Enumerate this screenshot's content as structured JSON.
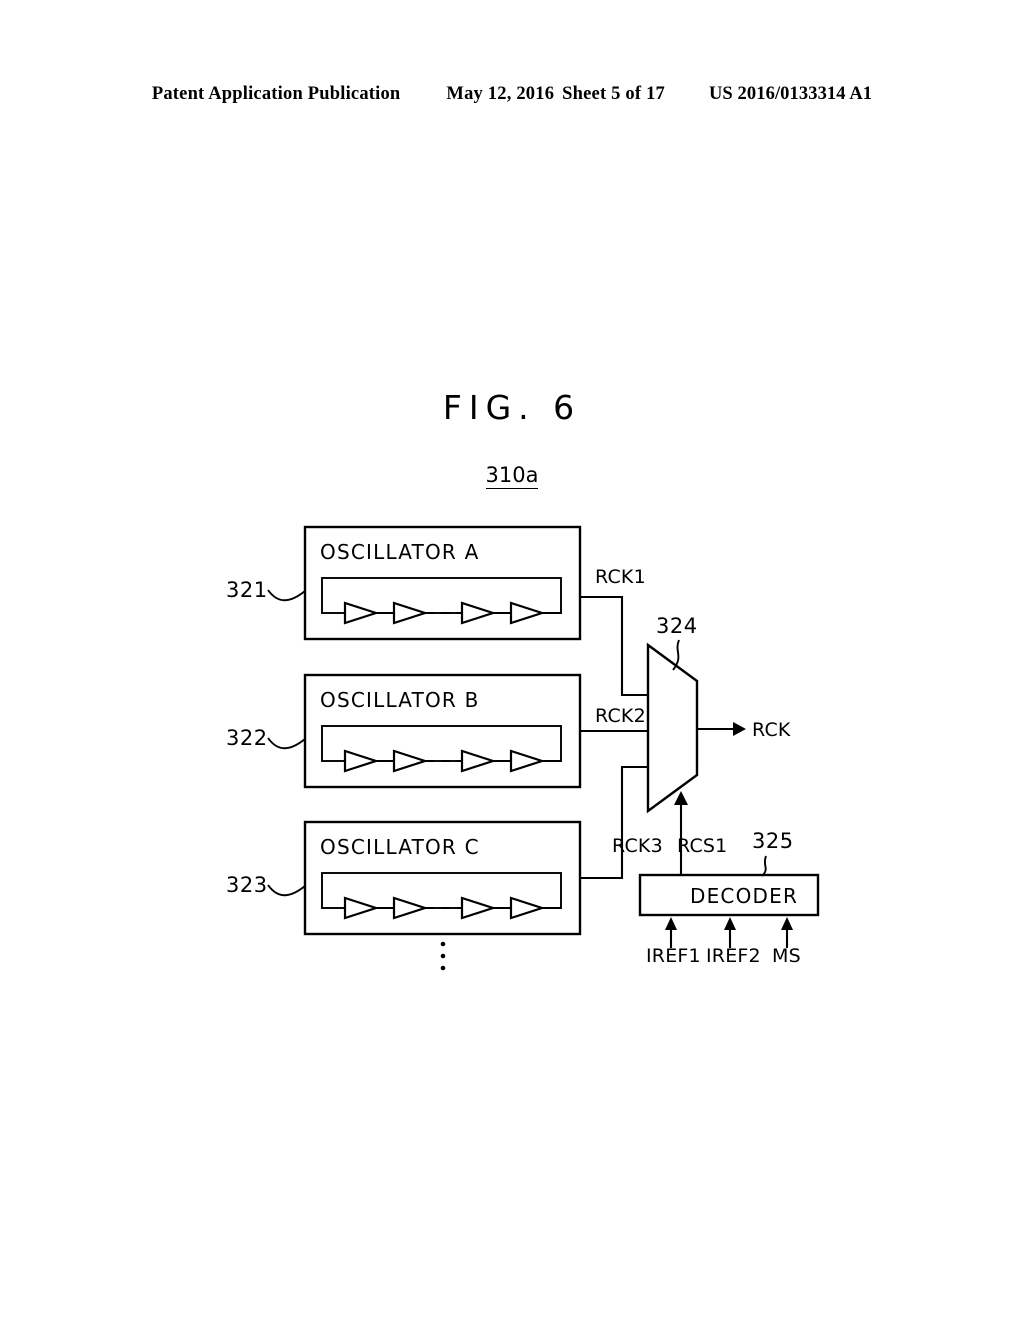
{
  "header": {
    "publication": "Patent Application Publication",
    "date": "May 12, 2016",
    "sheet": "Sheet 5 of 17",
    "number": "US 2016/0133314 A1"
  },
  "figure": {
    "title": "FIG. 6",
    "reference": "310a"
  },
  "blocks": {
    "oscillator_a": {
      "label": "OSCILLATOR A",
      "ref": "321",
      "output": "RCK1"
    },
    "oscillator_b": {
      "label": "OSCILLATOR B",
      "ref": "322",
      "output": "RCK2"
    },
    "oscillator_c": {
      "label": "OSCILLATOR C",
      "ref": "323",
      "output": "RCK3"
    },
    "mux": {
      "ref": "324",
      "output": "RCK",
      "select": "RCS1"
    },
    "decoder": {
      "label": "DECODER",
      "ref": "325"
    }
  },
  "decoder_inputs": [
    {
      "label": "IREF1"
    },
    {
      "label": "IREF2"
    },
    {
      "label": "MS"
    }
  ],
  "colors": {
    "ink": "#000000",
    "paper": "#ffffff"
  }
}
